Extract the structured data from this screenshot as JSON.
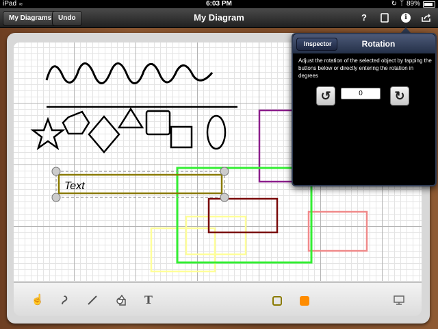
{
  "statusbar": {
    "device": "iPad",
    "time": "6:03 PM",
    "battery": "89%"
  },
  "toolbar": {
    "back_label": "My Diagrams",
    "undo_label": "Undo",
    "title": "My Diagram",
    "help_label": "?"
  },
  "canvas": {
    "text_label": "Text"
  },
  "tools": {
    "items": [
      "hand-tool-icon",
      "freehand-tool-icon",
      "line-tool-icon",
      "shape-tool-icon",
      "text-tool-icon"
    ],
    "text_tool_label": "T",
    "stroke_color": "#8a7a00",
    "fill_color": "#ff8c00"
  },
  "inspector": {
    "back_label": "Inspector",
    "title": "Rotation",
    "description": "Adjust the rotation of the selected object by tapping the buttons below or directly entering the rotation in degrees",
    "rotation_value": "0"
  }
}
